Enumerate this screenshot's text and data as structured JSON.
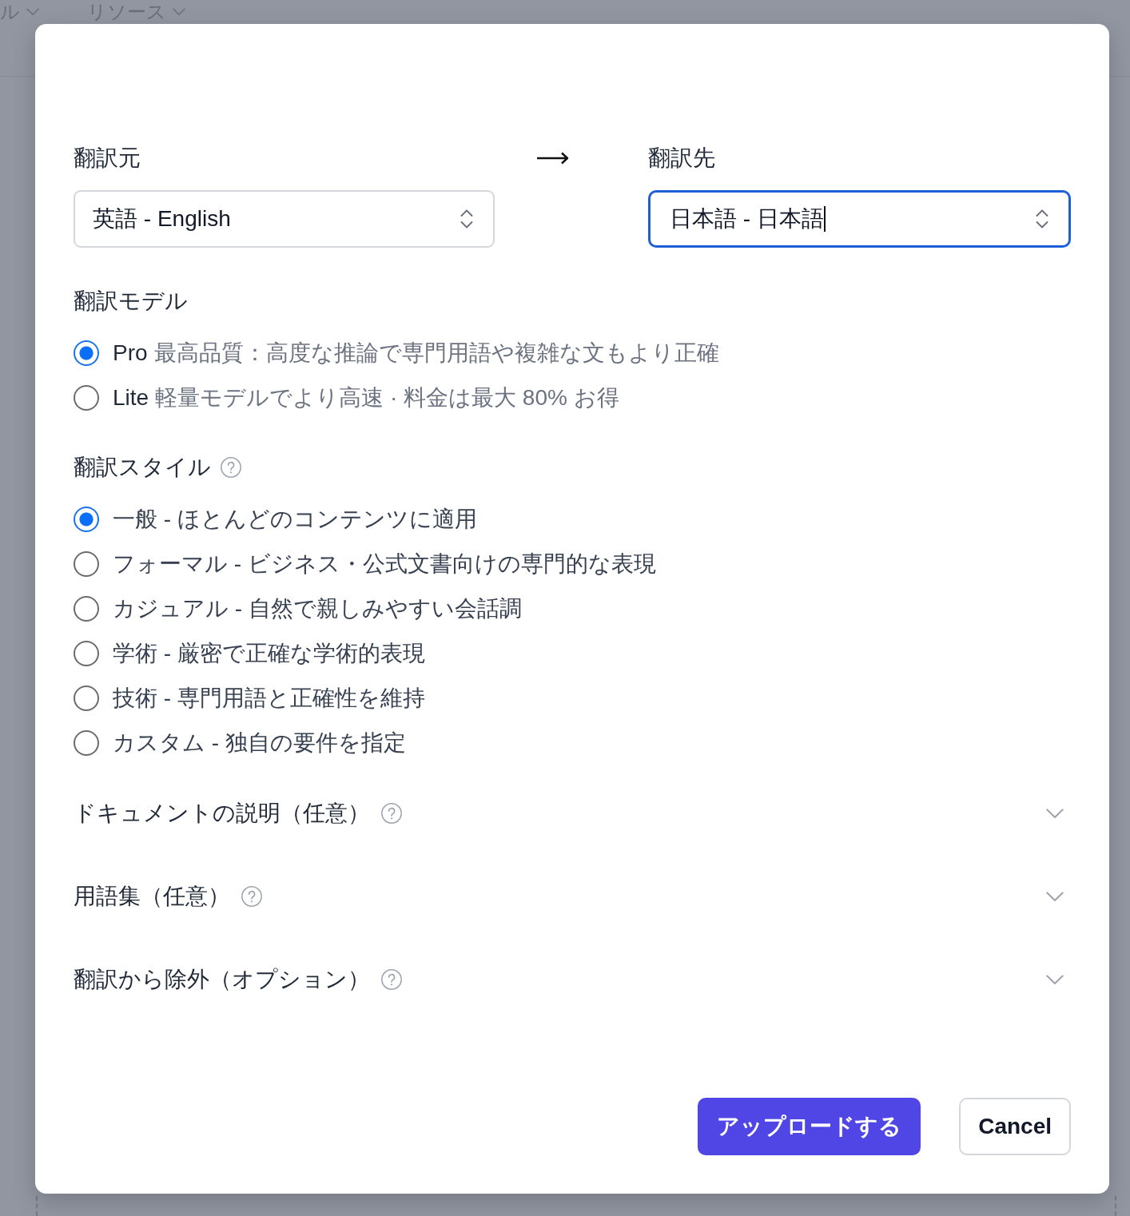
{
  "backdrop": {
    "nav_items": [
      {
        "label": "ル"
      },
      {
        "label": "リソース"
      }
    ]
  },
  "dialog": {
    "source": {
      "label": "翻訳元",
      "value": "英語 - English",
      "focused": false
    },
    "target": {
      "label": "翻訳先",
      "value": "日本語 - 日本語",
      "focused": true
    },
    "model": {
      "label": "翻訳モデル",
      "options": [
        {
          "name": "Pro",
          "description": "最高品質：高度な推論で専門用語や複雑な文もより正確",
          "selected": true
        },
        {
          "name": "Lite",
          "description": "軽量モデルでより高速 · 料金は最大 80% お得",
          "selected": false
        }
      ]
    },
    "style": {
      "label": "翻訳スタイル",
      "help": true,
      "options": [
        {
          "label": "一般 - ほとんどのコンテンツに適用",
          "selected": true
        },
        {
          "label": "フォーマル - ビジネス・公式文書向けの専門的な表現",
          "selected": false
        },
        {
          "label": "カジュアル - 自然で親しみやすい会話調",
          "selected": false
        },
        {
          "label": "学術 - 厳密で正確な学術的表現",
          "selected": false
        },
        {
          "label": "技術 - 専門用語と正確性を維持",
          "selected": false
        },
        {
          "label": "カスタム - 独自の要件を指定",
          "selected": false
        }
      ]
    },
    "sections": [
      {
        "title": "ドキュメントの説明（任意）",
        "help": true,
        "expanded": false
      },
      {
        "title": "用語集（任意）",
        "help": true,
        "expanded": false
      },
      {
        "title": "翻訳から除外（オプション）",
        "help": true,
        "expanded": false
      }
    ],
    "buttons": [
      {
        "label": "アップロードする",
        "kind": "primary"
      },
      {
        "label": "Cancel",
        "kind": "secondary"
      }
    ]
  }
}
